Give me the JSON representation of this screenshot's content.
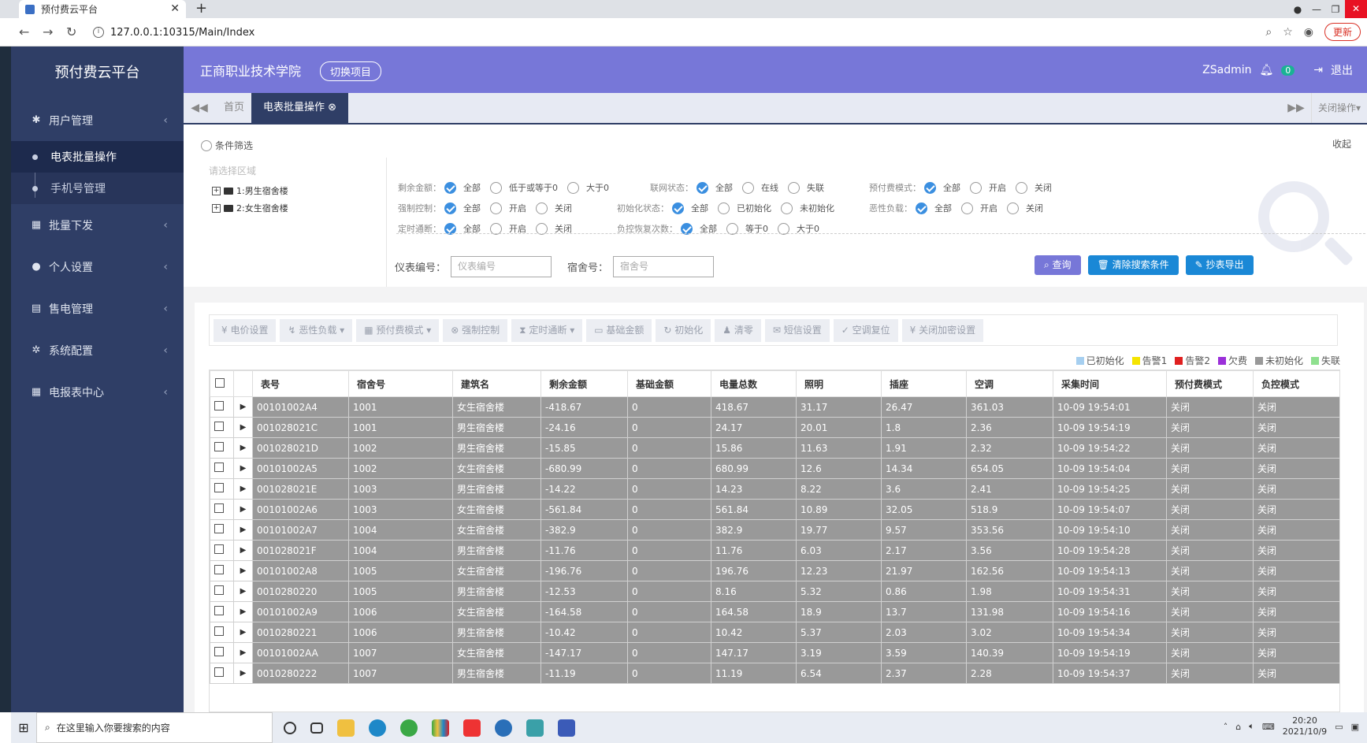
{
  "browser": {
    "tab_title": "预付费云平台",
    "url": "127.0.0.1:10315/Main/Index",
    "update_label": "更新"
  },
  "sidebar": {
    "logo": "预付费云平台",
    "menu": [
      {
        "label": "用户管理",
        "icon": "gear-icon"
      },
      {
        "label": "批量下发",
        "icon": "calendar-icon"
      },
      {
        "label": "个人设置",
        "icon": "user-icon"
      },
      {
        "label": "售电管理",
        "icon": "card-icon"
      },
      {
        "label": "系统配置",
        "icon": "cog-icon"
      },
      {
        "label": "电报表中心",
        "icon": "grid-icon"
      }
    ],
    "submenu": [
      {
        "label": "电表批量操作",
        "active": true
      },
      {
        "label": "手机号管理",
        "active": false
      }
    ]
  },
  "topbar": {
    "org": "正商职业技术学院",
    "switch_label": "切换项目",
    "username": "ZSadmin",
    "notif_count": "0",
    "logout": "退出"
  },
  "tabs": {
    "home": "首页",
    "current": "电表批量操作",
    "close_ops": "关闭操作"
  },
  "filter": {
    "title": "条件筛选",
    "collapse": "收起",
    "tree_label": "请选择区域",
    "tree_nodes": [
      "1:男生宿舍楼",
      "2:女生宿舍楼"
    ],
    "rows": [
      {
        "label": "剩余金额：",
        "options": [
          "全部",
          "低于或等于0",
          "大于0"
        ],
        "selected": 0
      },
      {
        "label": "联网状态：",
        "options": [
          "全部",
          "在线",
          "失联"
        ],
        "selected": 0
      },
      {
        "label": "预付费模式：",
        "options": [
          "全部",
          "开启",
          "关闭"
        ],
        "selected": 0
      },
      {
        "label": "强制控制：",
        "options": [
          "全部",
          "开启",
          "关闭"
        ],
        "selected": 0
      },
      {
        "label": "初始化状态：",
        "options": [
          "全部",
          "已初始化",
          "未初始化"
        ],
        "selected": 0
      },
      {
        "label": "恶性负载：",
        "options": [
          "全部",
          "开启",
          "关闭"
        ],
        "selected": 0
      },
      {
        "label": "定时通断：",
        "options": [
          "全部",
          "开启",
          "关闭"
        ],
        "selected": 0
      },
      {
        "label": "负控恢复次数：",
        "options": [
          "全部",
          "等于0",
          "大于0"
        ],
        "selected": 0
      }
    ],
    "meter_label": "仪表编号：",
    "meter_placeholder": "仪表编号",
    "room_label": "宿舍号：",
    "room_placeholder": "宿舍号",
    "query_btn": "查询",
    "clear_btn": "清除搜索条件",
    "export_btn": "抄表导出"
  },
  "toolbar": [
    "电价设置",
    "恶性负载",
    "预付费模式",
    "强制控制",
    "定时通断",
    "基础金额",
    "初始化",
    "清零",
    "短信设置",
    "空调复位",
    "关闭加密设置"
  ],
  "legend": [
    {
      "label": "已初始化",
      "color": "#a6cff0"
    },
    {
      "label": "告警1",
      "color": "#f5e400"
    },
    {
      "label": "告警2",
      "color": "#e02020"
    },
    {
      "label": "欠费",
      "color": "#9b30d9"
    },
    {
      "label": "未初始化",
      "color": "#999999"
    },
    {
      "label": "失联",
      "color": "#8fe08f"
    }
  ],
  "table": {
    "headers": [
      "表号",
      "宿舍号",
      "建筑名",
      "剩余金额",
      "基础金额",
      "电量总数",
      "照明",
      "插座",
      "空调",
      "采集时间",
      "预付费模式",
      "负控模式"
    ],
    "rows": [
      [
        "00101002A4",
        "1001",
        "女生宿舍楼",
        "-418.67",
        "0",
        "418.67",
        "31.17",
        "26.47",
        "361.03",
        "10-09 19:54:01",
        "关闭",
        "关闭"
      ],
      [
        "001028021C",
        "1001",
        "男生宿舍楼",
        "-24.16",
        "0",
        "24.17",
        "20.01",
        "1.8",
        "2.36",
        "10-09 19:54:19",
        "关闭",
        "关闭"
      ],
      [
        "001028021D",
        "1002",
        "男生宿舍楼",
        "-15.85",
        "0",
        "15.86",
        "11.63",
        "1.91",
        "2.32",
        "10-09 19:54:22",
        "关闭",
        "关闭"
      ],
      [
        "00101002A5",
        "1002",
        "女生宿舍楼",
        "-680.99",
        "0",
        "680.99",
        "12.6",
        "14.34",
        "654.05",
        "10-09 19:54:04",
        "关闭",
        "关闭"
      ],
      [
        "001028021E",
        "1003",
        "男生宿舍楼",
        "-14.22",
        "0",
        "14.23",
        "8.22",
        "3.6",
        "2.41",
        "10-09 19:54:25",
        "关闭",
        "关闭"
      ],
      [
        "00101002A6",
        "1003",
        "女生宿舍楼",
        "-561.84",
        "0",
        "561.84",
        "10.89",
        "32.05",
        "518.9",
        "10-09 19:54:07",
        "关闭",
        "关闭"
      ],
      [
        "00101002A7",
        "1004",
        "女生宿舍楼",
        "-382.9",
        "0",
        "382.9",
        "19.77",
        "9.57",
        "353.56",
        "10-09 19:54:10",
        "关闭",
        "关闭"
      ],
      [
        "001028021F",
        "1004",
        "男生宿舍楼",
        "-11.76",
        "0",
        "11.76",
        "6.03",
        "2.17",
        "3.56",
        "10-09 19:54:28",
        "关闭",
        "关闭"
      ],
      [
        "00101002A8",
        "1005",
        "女生宿舍楼",
        "-196.76",
        "0",
        "196.76",
        "12.23",
        "21.97",
        "162.56",
        "10-09 19:54:13",
        "关闭",
        "关闭"
      ],
      [
        "0010280220",
        "1005",
        "男生宿舍楼",
        "-12.53",
        "0",
        "8.16",
        "5.32",
        "0.86",
        "1.98",
        "10-09 19:54:31",
        "关闭",
        "关闭"
      ],
      [
        "00101002A9",
        "1006",
        "女生宿舍楼",
        "-164.58",
        "0",
        "164.58",
        "18.9",
        "13.7",
        "131.98",
        "10-09 19:54:16",
        "关闭",
        "关闭"
      ],
      [
        "0010280221",
        "1006",
        "男生宿舍楼",
        "-10.42",
        "0",
        "10.42",
        "5.37",
        "2.03",
        "3.02",
        "10-09 19:54:34",
        "关闭",
        "关闭"
      ],
      [
        "00101002AA",
        "1007",
        "女生宿舍楼",
        "-147.17",
        "0",
        "147.17",
        "3.19",
        "3.59",
        "140.39",
        "10-09 19:54:19",
        "关闭",
        "关闭"
      ],
      [
        "0010280222",
        "1007",
        "男生宿舍楼",
        "-11.19",
        "0",
        "11.19",
        "6.54",
        "2.37",
        "2.28",
        "10-09 19:54:37",
        "关闭",
        "关闭"
      ]
    ]
  },
  "taskbar": {
    "search_placeholder": "在这里输入你要搜索的内容",
    "time": "20:20",
    "date": "2021/10/9"
  }
}
